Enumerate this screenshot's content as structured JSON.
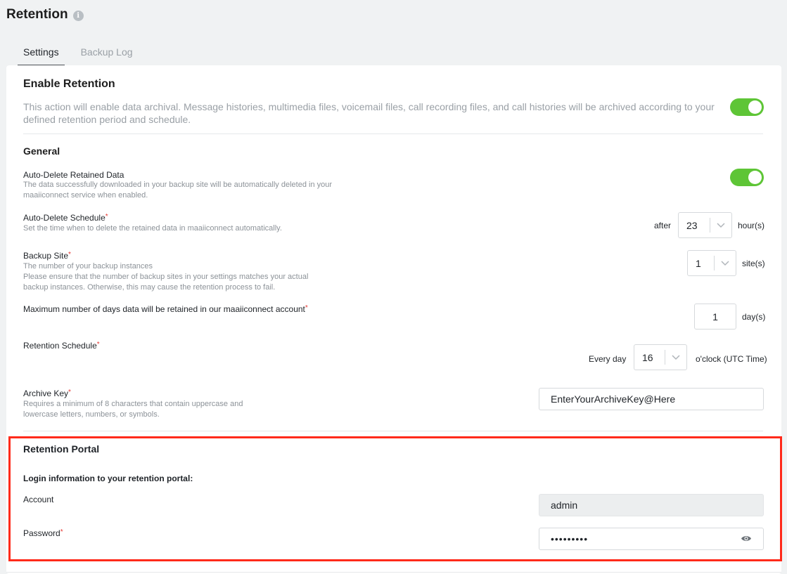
{
  "header": {
    "title": "Retention"
  },
  "tabs": [
    {
      "label": "Settings",
      "active": true
    },
    {
      "label": "Backup Log",
      "active": false
    }
  ],
  "enable_retention": {
    "title": "Enable Retention",
    "description_line1": "This action will enable data archival. Message histories, multimedia files, voicemail files, call recording files, and call histories will be archived according to your",
    "description_line2": "defined retention period and schedule.",
    "enabled": true
  },
  "general": {
    "title": "General",
    "auto_delete": {
      "label": "Auto-Delete Retained Data",
      "desc_line1": "The data successfully downloaded in your backup site will be automatically deleted in your",
      "desc_line2": "maaiiconnect service when enabled.",
      "enabled": true
    },
    "auto_delete_schedule": {
      "label": "Auto-Delete Schedule",
      "required": "*",
      "desc": "Set the time when to delete the retained data in maaiiconnect automatically.",
      "prefix": "after",
      "value": "23",
      "suffix": "hour(s)"
    },
    "backup_site": {
      "label": "Backup Site",
      "required": "*",
      "desc_line1": "The number of your backup instances",
      "desc_line2": "Please ensure that the number of backup sites in your settings matches your actual",
      "desc_line3": "backup instances. Otherwise, this may cause the retention process to fail.",
      "value": "1",
      "suffix": "site(s)"
    },
    "max_days": {
      "label": "Maximum number of days data will be retained in our maaiiconnect account",
      "required": "*",
      "value": "1",
      "suffix": "day(s)"
    },
    "retention_schedule": {
      "label": "Retention Schedule",
      "required": "*",
      "prefix": "Every day",
      "value": "16",
      "suffix": "o'clock (UTC Time)"
    },
    "archive_key": {
      "label": "Archive Key",
      "required": "*",
      "desc_line1": "Requires a minimum of 8 characters that contain uppercase and",
      "desc_line2": "lowercase letters, numbers, or symbols.",
      "value": "EnterYourArchiveKey@Here"
    }
  },
  "portal": {
    "title": "Retention Portal",
    "subtitle": "Login information to your retention portal:",
    "account_label": "Account",
    "account_value": "admin",
    "password_label": "Password",
    "password_required": "*",
    "password_value": "•••••••••"
  },
  "colors": {
    "toggle_on": "#5ec536",
    "highlight": "#ff2a1a",
    "required": "#e53935"
  },
  "icons": {
    "info": "info-icon",
    "chevron": "chevron-down-icon",
    "eye": "eye-icon"
  }
}
